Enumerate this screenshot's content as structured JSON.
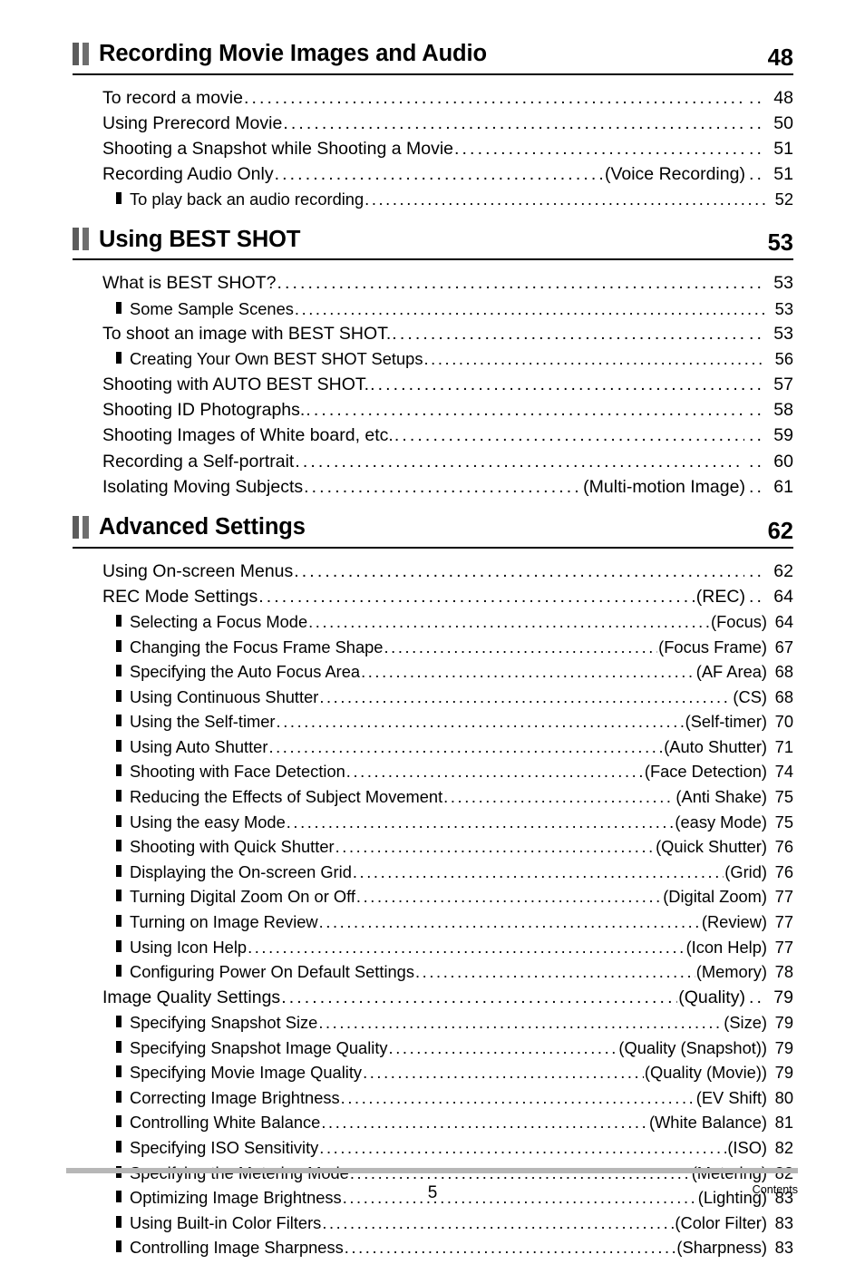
{
  "document": {
    "footer": {
      "page_number": "5",
      "section_label": "Contents"
    }
  },
  "sections": [
    {
      "title": "Recording Movie Images and Audio",
      "page": "48",
      "entries": [
        {
          "level": 1,
          "text": "To record a movie",
          "paren": "",
          "page": "48"
        },
        {
          "level": 1,
          "text": "Using Prerecord Movie",
          "paren": "",
          "page": "50"
        },
        {
          "level": 1,
          "text": "Shooting a Snapshot while Shooting a Movie",
          "paren": "",
          "page": "51"
        },
        {
          "level": 1,
          "text": "Recording Audio Only",
          "paren": "(Voice Recording)",
          "page": "51"
        },
        {
          "level": 2,
          "text": "To play back an audio recording",
          "paren": "",
          "page": "52"
        }
      ]
    },
    {
      "title": "Using BEST SHOT",
      "page": "53",
      "entries": [
        {
          "level": 1,
          "text": "What is BEST SHOT?",
          "paren": "",
          "page": "53"
        },
        {
          "level": 2,
          "text": "Some Sample Scenes",
          "paren": "",
          "page": "53"
        },
        {
          "level": 1,
          "text": "To shoot an image with BEST SHOT.",
          "paren": "",
          "page": "53"
        },
        {
          "level": 2,
          "text": "Creating Your Own BEST SHOT Setups",
          "paren": "",
          "page": "56"
        },
        {
          "level": 1,
          "text": "Shooting with AUTO BEST SHOT.",
          "paren": "",
          "page": "57"
        },
        {
          "level": 1,
          "text": "Shooting ID Photographs.",
          "paren": "",
          "page": "58"
        },
        {
          "level": 1,
          "text": "Shooting Images of White board, etc.",
          "paren": "",
          "page": "59"
        },
        {
          "level": 1,
          "text": "Recording a Self-portrait",
          "paren": "",
          "page": "60"
        },
        {
          "level": 1,
          "text": "Isolating Moving Subjects",
          "paren": "(Multi-motion Image)",
          "page": "61"
        }
      ]
    },
    {
      "title": "Advanced Settings",
      "page": "62",
      "entries": [
        {
          "level": 1,
          "text": "Using On-screen Menus",
          "paren": "",
          "page": "62"
        },
        {
          "level": 1,
          "text": "REC Mode Settings",
          "paren": "(REC)",
          "page": "64"
        },
        {
          "level": 2,
          "text": "Selecting a Focus Mode",
          "paren": "(Focus)",
          "page": "64"
        },
        {
          "level": 2,
          "text": "Changing the Focus Frame Shape",
          "paren": "(Focus Frame)",
          "page": "67"
        },
        {
          "level": 2,
          "text": "Specifying the Auto Focus Area",
          "paren": "(AF Area)",
          "page": "68"
        },
        {
          "level": 2,
          "text": "Using Continuous Shutter",
          "paren": "(CS)",
          "page": "68"
        },
        {
          "level": 2,
          "text": "Using the Self-timer",
          "paren": "(Self-timer)",
          "page": "70"
        },
        {
          "level": 2,
          "text": "Using Auto Shutter",
          "paren": "(Auto Shutter)",
          "page": "71"
        },
        {
          "level": 2,
          "text": "Shooting with Face Detection",
          "paren": "(Face Detection)",
          "page": "74"
        },
        {
          "level": 2,
          "text": "Reducing the Effects of Subject Movement",
          "paren": "(Anti Shake)",
          "page": "75"
        },
        {
          "level": 2,
          "text": "Using the easy Mode",
          "paren": "(easy Mode)",
          "page": "75"
        },
        {
          "level": 2,
          "text": "Shooting with Quick Shutter",
          "paren": "(Quick Shutter)",
          "page": "76"
        },
        {
          "level": 2,
          "text": "Displaying the On-screen Grid",
          "paren": "(Grid)",
          "page": "76"
        },
        {
          "level": 2,
          "text": "Turning Digital Zoom On or Off",
          "paren": "(Digital Zoom)",
          "page": "77"
        },
        {
          "level": 2,
          "text": "Turning on Image Review",
          "paren": "(Review)",
          "page": "77"
        },
        {
          "level": 2,
          "text": "Using Icon Help",
          "paren": "(Icon Help)",
          "page": "77"
        },
        {
          "level": 2,
          "text": "Configuring Power On Default Settings",
          "paren": "(Memory)",
          "page": "78"
        },
        {
          "level": 1,
          "text": "Image Quality Settings",
          "paren": "(Quality)",
          "page": "79"
        },
        {
          "level": 2,
          "text": "Specifying Snapshot Size",
          "paren": "(Size)",
          "page": "79"
        },
        {
          "level": 2,
          "text": "Specifying Snapshot Image Quality",
          "paren": "(Quality (Snapshot))",
          "page": "79"
        },
        {
          "level": 2,
          "text": "Specifying Movie Image Quality",
          "paren": "(Quality (Movie))",
          "page": "79"
        },
        {
          "level": 2,
          "text": "Correcting Image Brightness",
          "paren": "(EV Shift)",
          "page": "80"
        },
        {
          "level": 2,
          "text": "Controlling White Balance",
          "paren": "(White Balance)",
          "page": "81"
        },
        {
          "level": 2,
          "text": "Specifying ISO Sensitivity",
          "paren": "(ISO)",
          "page": "82"
        },
        {
          "level": 2,
          "text": "Specifying the Metering Mode",
          "paren": "(Metering)",
          "page": "82"
        },
        {
          "level": 2,
          "text": "Optimizing Image Brightness",
          "paren": "(Lighting)",
          "page": "83"
        },
        {
          "level": 2,
          "text": "Using Built-in Color Filters",
          "paren": "(Color Filter)",
          "page": "83"
        },
        {
          "level": 2,
          "text": "Controlling Image Sharpness",
          "paren": "(Sharpness)",
          "page": "83"
        }
      ]
    }
  ]
}
